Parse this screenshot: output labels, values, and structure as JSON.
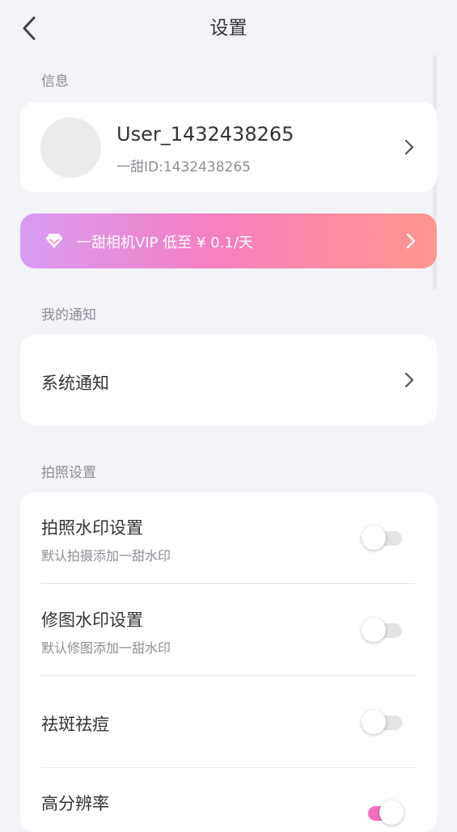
{
  "header": {
    "title": "设置"
  },
  "sections": {
    "info": "信息",
    "notifications": "我的通知",
    "photo_settings": "拍照设置"
  },
  "user": {
    "name": "User_1432438265",
    "id_line": "一甜ID:1432438265"
  },
  "vip": {
    "text": "一甜相机VIP 低至 ¥ 0.1/天"
  },
  "notifications": {
    "system_label": "系统通知"
  },
  "settings": [
    {
      "title": "拍照水印设置",
      "subtitle": "默认拍摄添加一甜水印",
      "enabled": false
    },
    {
      "title": "修图水印设置",
      "subtitle": "默认修图添加一甜水印",
      "enabled": false
    },
    {
      "title": "祛斑祛痘",
      "subtitle": "",
      "enabled": false
    },
    {
      "title": "高分辨率",
      "subtitle": "",
      "enabled": true
    }
  ],
  "colors": {
    "background": "#f3f4f8",
    "toggle_on": "#f56fbd",
    "vip_gradient_start": "#d79cf4",
    "vip_gradient_end": "#ff968f"
  }
}
